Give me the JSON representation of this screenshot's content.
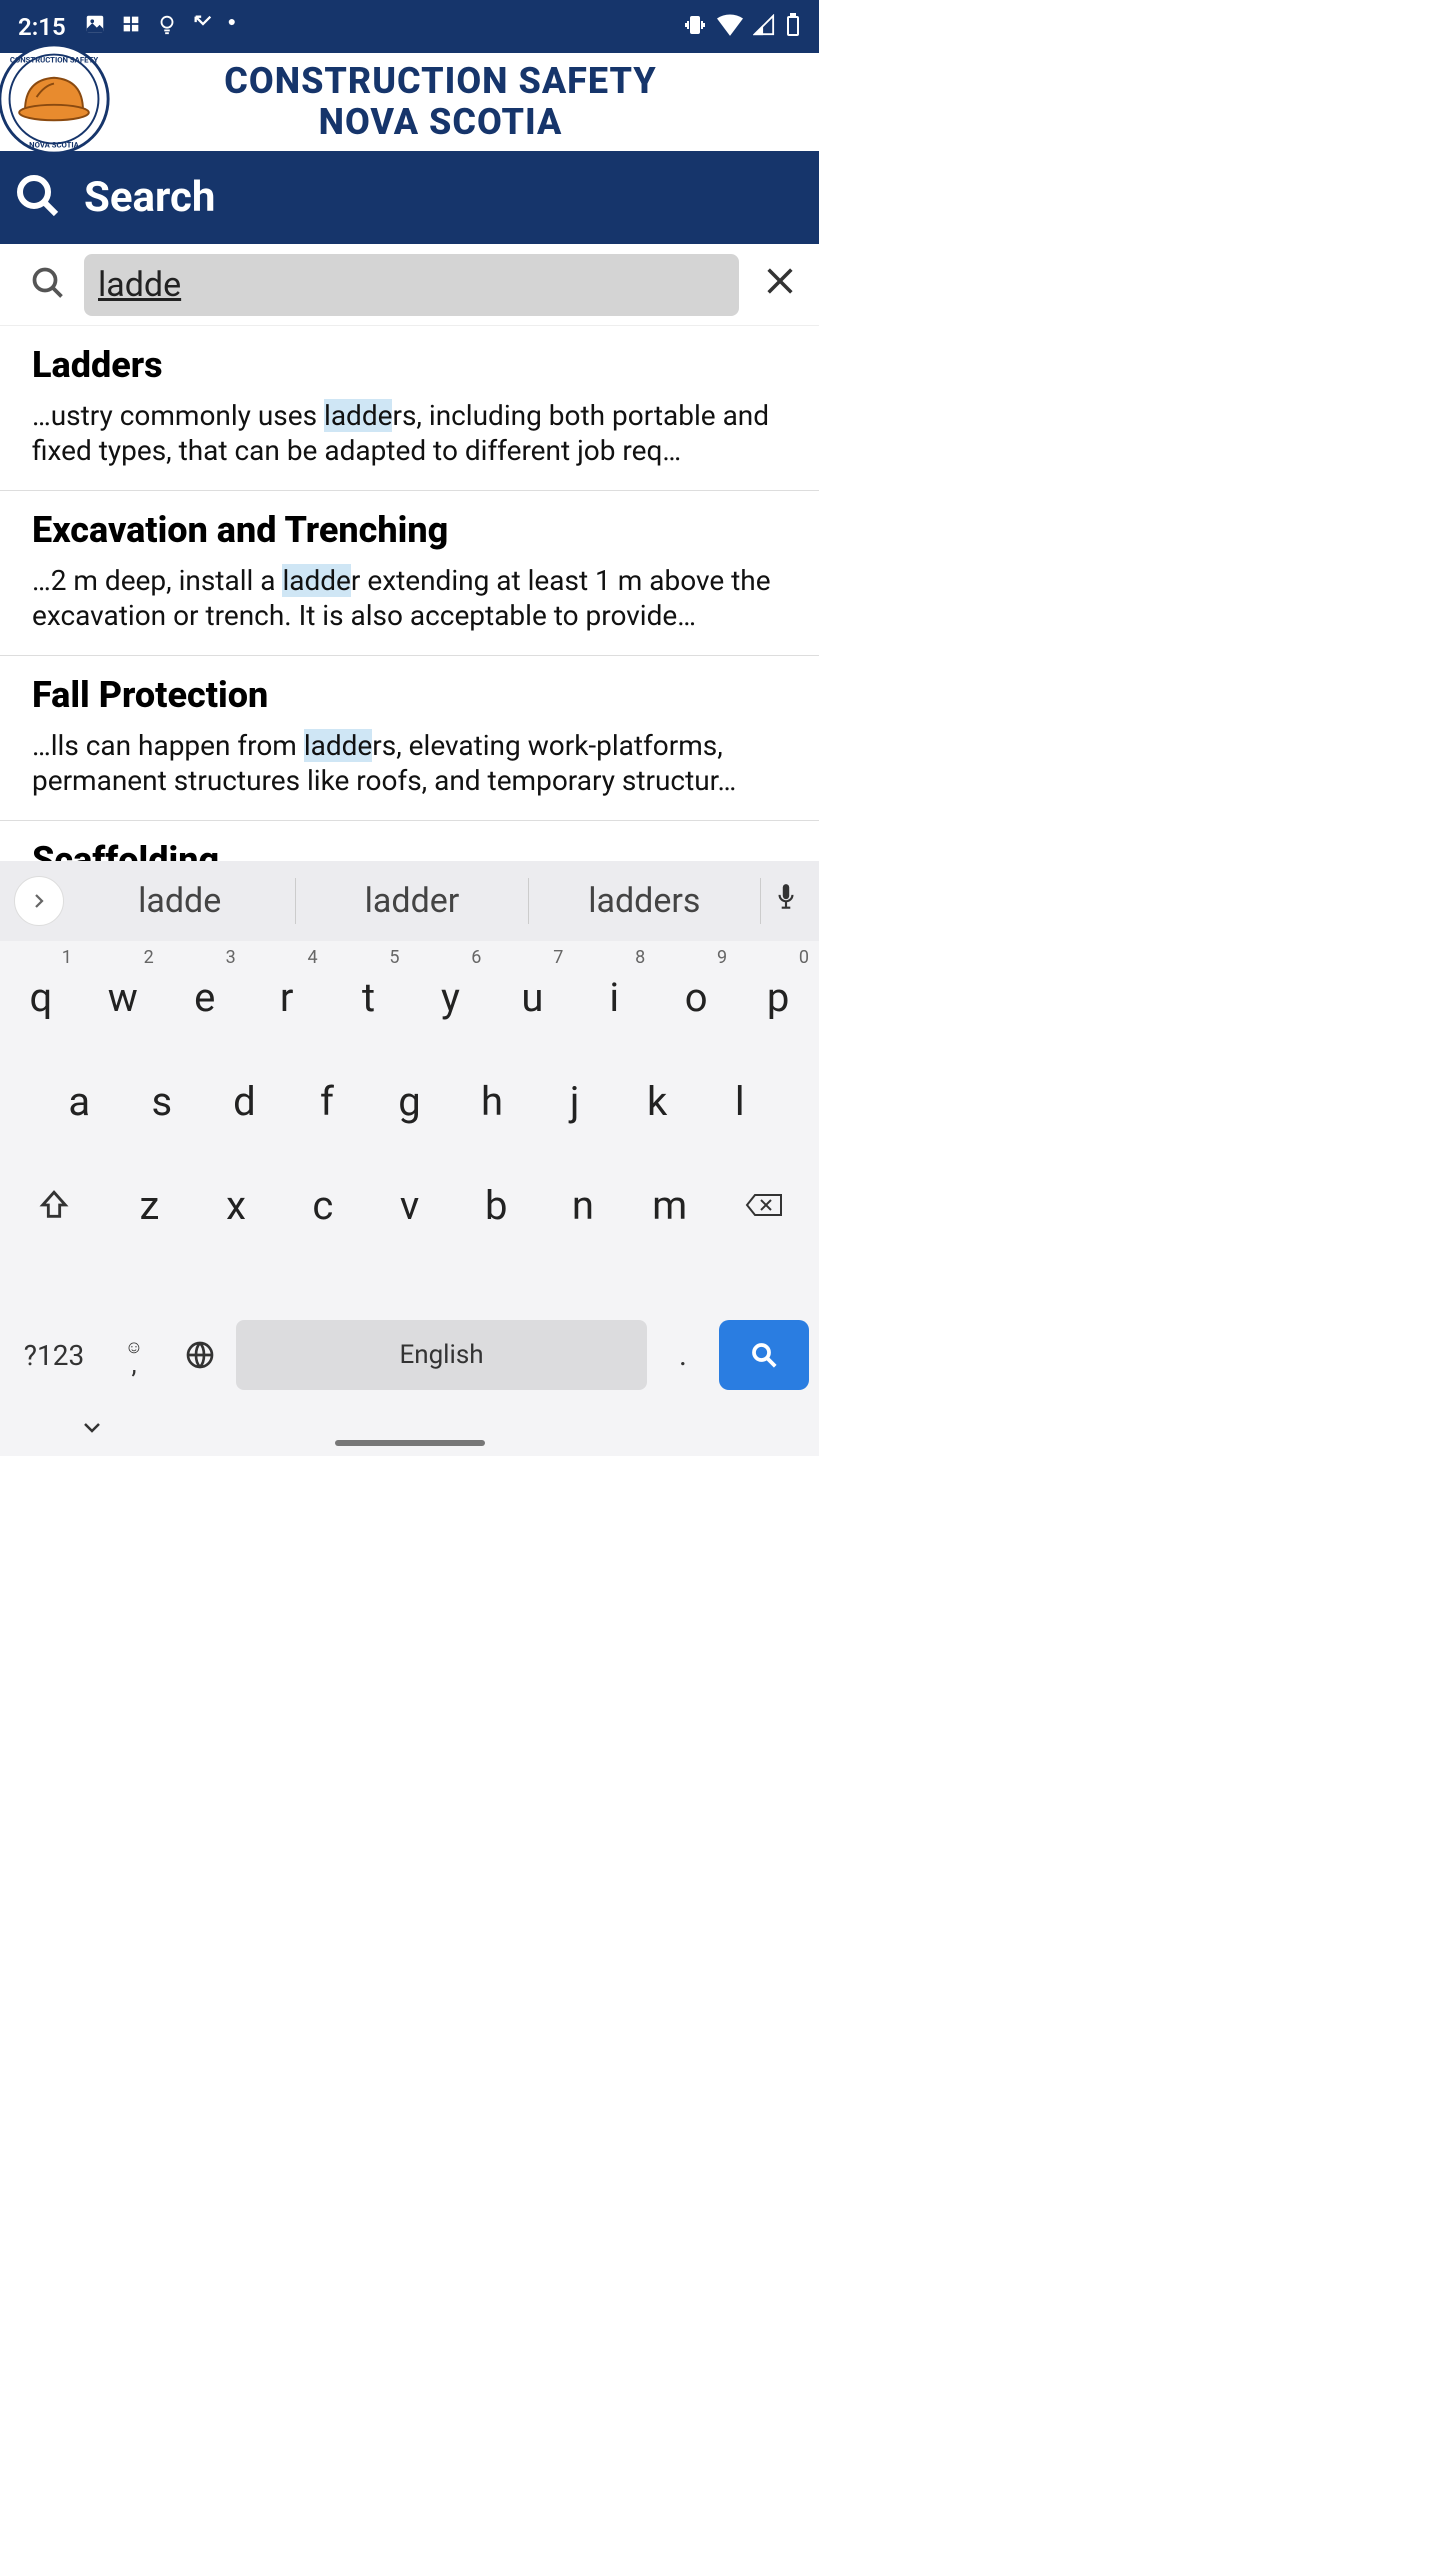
{
  "status_bar": {
    "time": "2:15"
  },
  "header": {
    "title_line1": "CONSTRUCTION SAFETY",
    "title_line2": "NOVA SCOTIA"
  },
  "search": {
    "title": "Search",
    "value": "ladde"
  },
  "results": [
    {
      "title": "Ladders",
      "pre": "…ustry commonly uses ",
      "hl": "ladde",
      "post": "rs, including both portable and fixed types, that can be adapted to different job req…"
    },
    {
      "title": "Excavation and Trenching",
      "pre": "…2 m deep, install a ",
      "hl": "ladde",
      "post": "r extending at least 1 m above the excavation or trench. It is also acceptable to provide…"
    },
    {
      "title": "Fall Protection",
      "pre": "…lls can happen from ",
      "hl": "ladde",
      "post": "rs, elevating work-platforms, permanent structures like roofs, and temporary structur…"
    },
    {
      "title": "Scaffolding",
      "pre": "",
      "hl": "",
      "post": ""
    }
  ],
  "keyboard": {
    "suggestions": [
      "ladde",
      "ladder",
      "ladders"
    ],
    "row1": [
      {
        "k": "q",
        "a": "1"
      },
      {
        "k": "w",
        "a": "2"
      },
      {
        "k": "e",
        "a": "3"
      },
      {
        "k": "r",
        "a": "4"
      },
      {
        "k": "t",
        "a": "5"
      },
      {
        "k": "y",
        "a": "6"
      },
      {
        "k": "u",
        "a": "7"
      },
      {
        "k": "i",
        "a": "8"
      },
      {
        "k": "o",
        "a": "9"
      },
      {
        "k": "p",
        "a": "0"
      }
    ],
    "row2": [
      "a",
      "s",
      "d",
      "f",
      "g",
      "h",
      "j",
      "k",
      "l"
    ],
    "row3": [
      "z",
      "x",
      "c",
      "v",
      "b",
      "n",
      "m"
    ],
    "numeric_label": "?123",
    "space_label": "English",
    "comma": ",",
    "period": "."
  }
}
